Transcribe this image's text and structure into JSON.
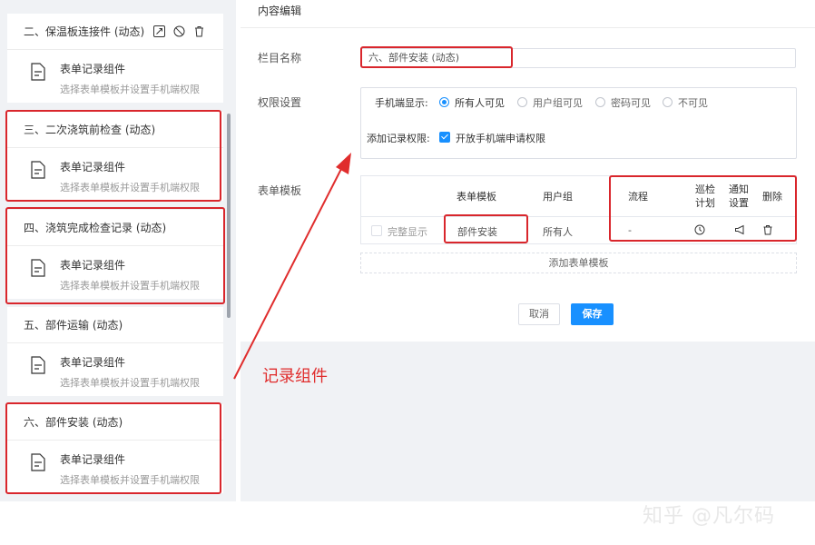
{
  "left_panel": {
    "sections": [
      {
        "title": "二、保温板连接件 (动态)",
        "comp_title": "表单记录组件",
        "comp_desc": "选择表单模板并设置手机端权限"
      },
      {
        "title": "三、二次浇筑前检查 (动态)",
        "comp_title": "表单记录组件",
        "comp_desc": "选择表单模板并设置手机端权限"
      },
      {
        "title": "四、浇筑完成检查记录 (动态)",
        "comp_title": "表单记录组件",
        "comp_desc": "选择表单模板并设置手机端权限"
      },
      {
        "title": "五、部件运输 (动态)",
        "comp_title": "表单记录组件",
        "comp_desc": "选择表单模板并设置手机端权限"
      },
      {
        "title": "六、部件安装 (动态)",
        "comp_title": "表单记录组件",
        "comp_desc": "选择表单模板并设置手机端权限"
      }
    ],
    "head_icons": [
      "edit-icon",
      "disable-icon",
      "trash-icon"
    ]
  },
  "content": {
    "title": "内容编辑",
    "column_name_label": "栏目名称",
    "column_name_value": "六、部件安装 (动态)",
    "permission_label": "权限设置",
    "mobile_display_label": "手机端显示:",
    "mobile_display_options": [
      "所有人可见",
      "用户组可见",
      "密码可见",
      "不可见"
    ],
    "mobile_display_selected": "所有人可见",
    "add_record_label": "添加记录权限:",
    "add_record_option": "开放手机端申请权限",
    "add_record_checked": true,
    "template_label": "表单模板",
    "table": {
      "headers": {
        "template": "表单模板",
        "user_group": "用户组",
        "flow": "流程",
        "patrol_line1": "巡检",
        "patrol_line2": "计划",
        "notify_line1": "通知",
        "notify_line2": "设置",
        "delete": "删除"
      },
      "row": {
        "full_display": "完整显示",
        "template": "部件安装",
        "user_group": "所有人",
        "flow": "-"
      }
    },
    "add_template": "添加表单模板",
    "cancel": "取消",
    "save": "保存"
  },
  "annotation": "记录组件",
  "watermark": "知乎 @凡尔码",
  "colors": {
    "accent": "#1890ff",
    "highlight": "#d9262c",
    "panel_bg": "#f0f2f5"
  }
}
